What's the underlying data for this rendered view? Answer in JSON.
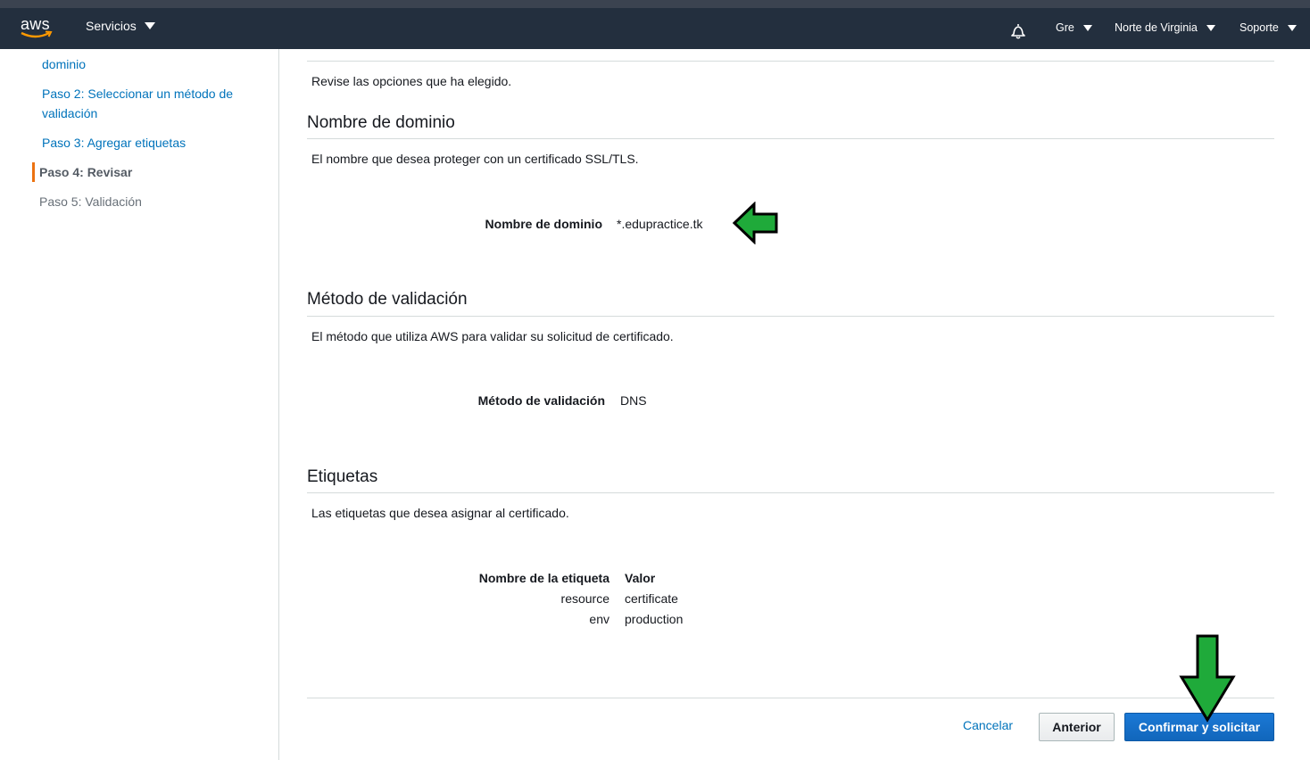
{
  "topbar": {
    "logo_text": "aws",
    "services_label": "Servicios",
    "user_label": "Gre",
    "region_label": "Norte de Virginia",
    "support_label": "Soporte"
  },
  "sidebar": {
    "items": [
      {
        "label": "dominio"
      },
      {
        "label": "Paso 2: Seleccionar un método de validación"
      },
      {
        "label": "Paso 3: Agregar etiquetas"
      },
      {
        "label": "Paso 4: Revisar"
      },
      {
        "label": "Paso 5: Validación"
      }
    ]
  },
  "main": {
    "intro": "Revise las opciones que ha elegido.",
    "domain_section": {
      "title": "Nombre de dominio",
      "description": "El nombre que desea proteger con un certificado SSL/TLS.",
      "field_label": "Nombre de dominio",
      "field_value": "*.edupractice.tk"
    },
    "validation_section": {
      "title": "Método de validación",
      "description": "El método que utiliza AWS para validar su solicitud de certificado.",
      "field_label": "Método de validación",
      "field_value": "DNS"
    },
    "tags_section": {
      "title": "Etiquetas",
      "description": "Las etiquetas que desea asignar al certificado.",
      "key_header": "Nombre de la etiqueta",
      "value_header": "Valor",
      "rows": [
        {
          "key": "resource",
          "value": "certificate"
        },
        {
          "key": "env",
          "value": "production"
        }
      ]
    }
  },
  "footer": {
    "cancel_label": "Cancelar",
    "previous_label": "Anterior",
    "confirm_label": "Confirmar y solicitar"
  },
  "colors": {
    "nav_bg": "#232f3e",
    "link": "#0073bb",
    "primary_button": "#1166bb",
    "annotation_arrow": "#1faa3a",
    "current_step_marker": "#ec7211"
  },
  "icons": [
    "aws-logo",
    "caret-down-icon",
    "bell-icon",
    "green-arrow-left-icon",
    "green-arrow-down-icon"
  ]
}
